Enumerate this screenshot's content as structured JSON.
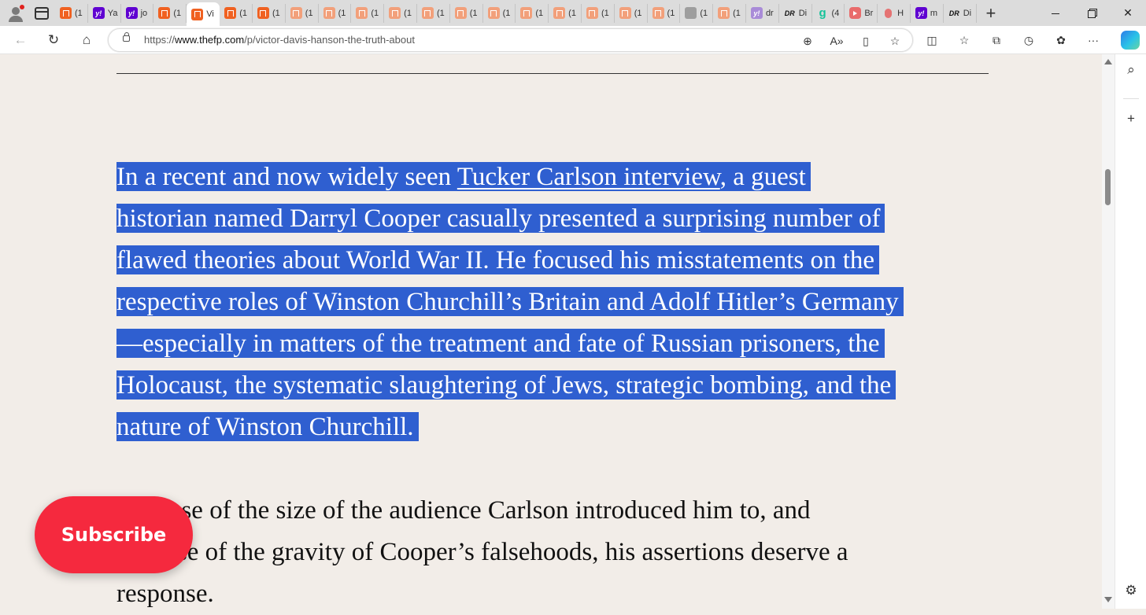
{
  "browser": {
    "tabs": [
      {
        "icon": "substack",
        "label": "(1"
      },
      {
        "icon": "yahoo",
        "label": "Ya"
      },
      {
        "icon": "yahoo",
        "label": "jo"
      },
      {
        "icon": "substack",
        "label": "(1"
      },
      {
        "icon": "substack",
        "label": "Vi",
        "active": true
      },
      {
        "icon": "substack",
        "label": "(1"
      },
      {
        "icon": "substack",
        "label": "(1"
      },
      {
        "icon": "substack-faded",
        "label": "(1"
      },
      {
        "icon": "substack-faded",
        "label": "(1"
      },
      {
        "icon": "substack-faded",
        "label": "(1"
      },
      {
        "icon": "substack-faded",
        "label": "(1"
      },
      {
        "icon": "substack-faded",
        "label": "(1"
      },
      {
        "icon": "substack-faded",
        "label": "(1"
      },
      {
        "icon": "substack-faded",
        "label": "(1"
      },
      {
        "icon": "substack-faded",
        "label": "(1"
      },
      {
        "icon": "substack-faded",
        "label": "(1"
      },
      {
        "icon": "substack-faded",
        "label": "(1"
      },
      {
        "icon": "substack-faded",
        "label": "(1"
      },
      {
        "icon": "substack-faded",
        "label": "(1"
      },
      {
        "icon": "image",
        "label": "(1"
      },
      {
        "icon": "substack-faded",
        "label": "(1"
      },
      {
        "icon": "yahoo-faded",
        "label": "dr"
      },
      {
        "icon": "dr",
        "label": "Di"
      },
      {
        "icon": "grammarly",
        "label": "(4"
      },
      {
        "icon": "youtube",
        "label": "Br"
      },
      {
        "icon": "podcast",
        "label": "H"
      },
      {
        "icon": "yahoo",
        "label": "m"
      },
      {
        "icon": "dr",
        "label": "Di"
      }
    ],
    "new_tab_label": "+",
    "address": {
      "scheme": "https://",
      "host": "www.thefp.com",
      "path": "/p/victor-davis-hanson-the-truth-about"
    }
  },
  "article": {
    "paragraph1": {
      "before_link": "In a recent and now widely seen ",
      "link_text": "Tucker Carlson interview",
      "after_link": ", a guest\nhistorian named Darryl Cooper casually presented a surprising number of\nflawed theories about World War II. He focused his misstatements on the\nrespective roles of Winston Churchill’s Britain and Adolf Hitler’s Germany\n—especially in matters of the treatment and fate of Russian prisoners, the\nHolocaust, the systematic slaughtering of Jews, strategic bombing, and the\nnature of Winston Churchill."
    },
    "paragraph2": "Because of the size of the audience Carlson introduced him to, and\nbecause of the gravity of Cooper’s falsehoods, his assertions deserve a\nresponse."
  },
  "subscribe_label": "Subscribe",
  "colors": {
    "page_bg": "#f2ede8",
    "selection": "#2f5fd0",
    "subscribe": "#f5293e"
  }
}
